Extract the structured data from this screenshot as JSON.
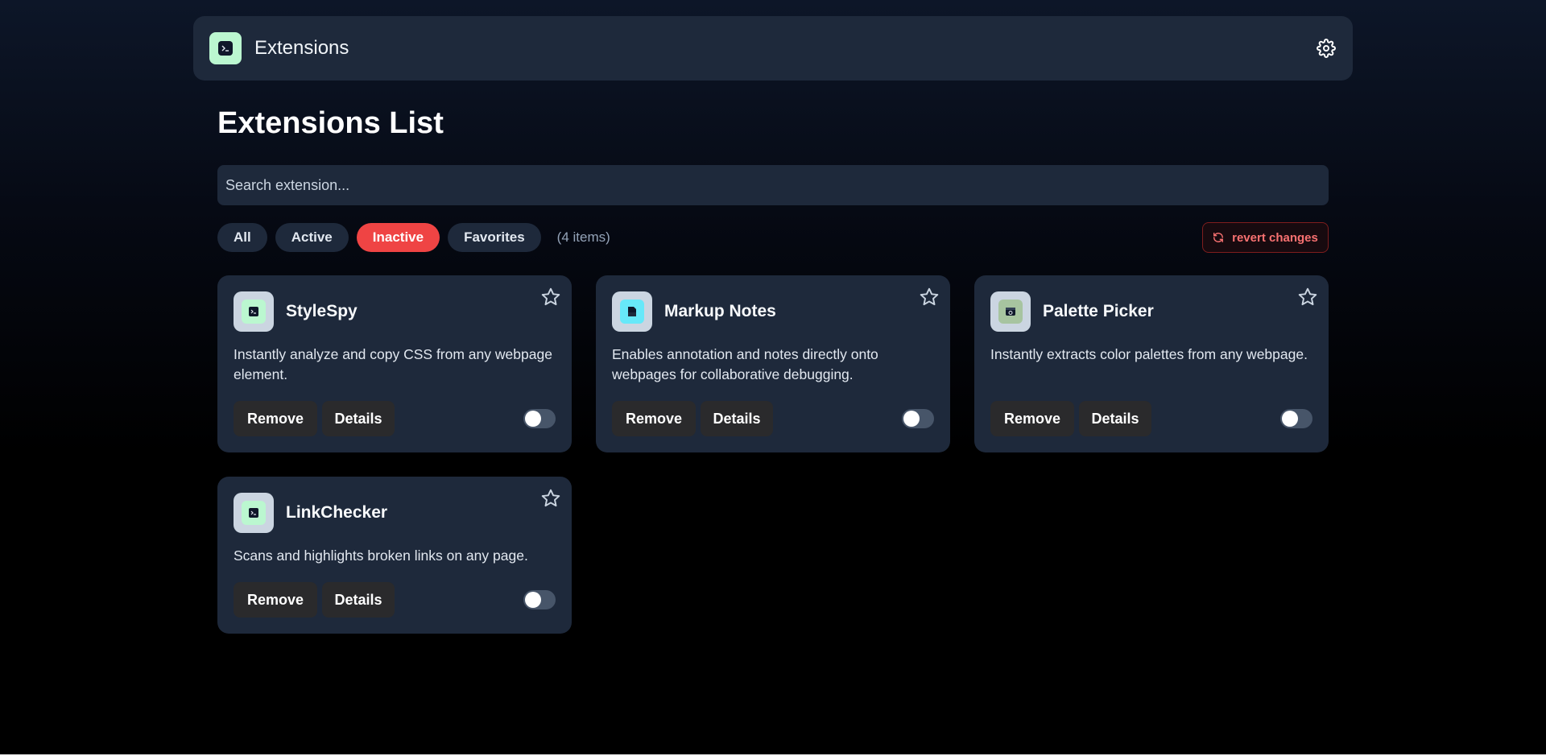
{
  "header": {
    "title": "Extensions",
    "logo_icon": "terminal-icon",
    "settings_icon": "gear-icon"
  },
  "page": {
    "title": "Extensions List"
  },
  "search": {
    "placeholder": "Search extension..."
  },
  "filters": {
    "items": [
      {
        "label": "All",
        "active": false
      },
      {
        "label": "Active",
        "active": false
      },
      {
        "label": "Inactive",
        "active": true
      },
      {
        "label": "Favorites",
        "active": false
      }
    ],
    "count_text": "(4 items)"
  },
  "revert": {
    "label": "revert changes",
    "icon": "refresh-icon"
  },
  "colors": {
    "accent": "#ef4444",
    "card_bg": "#1e293b",
    "header_bg": "#1e293b",
    "danger_text": "#f87171"
  },
  "extensions": [
    {
      "name": "StyleSpy",
      "description": "Instantly analyze and copy CSS from any webpage element.",
      "icon": "terminal-icon",
      "remove_label": "Remove",
      "details_label": "Details",
      "enabled": false,
      "favorite": false
    },
    {
      "name": "Markup Notes",
      "description": "Enables annotation and notes directly onto webpages for collaborative debugging.",
      "icon": "note-icon",
      "remove_label": "Remove",
      "details_label": "Details",
      "enabled": false,
      "favorite": false
    },
    {
      "name": "Palette Picker",
      "description": "Instantly extracts color palettes from any webpage.",
      "icon": "palette-icon",
      "remove_label": "Remove",
      "details_label": "Details",
      "enabled": false,
      "favorite": false
    },
    {
      "name": "LinkChecker",
      "description": "Scans and highlights broken links on any page.",
      "icon": "terminal-icon",
      "remove_label": "Remove",
      "details_label": "Details",
      "enabled": false,
      "favorite": false
    }
  ]
}
